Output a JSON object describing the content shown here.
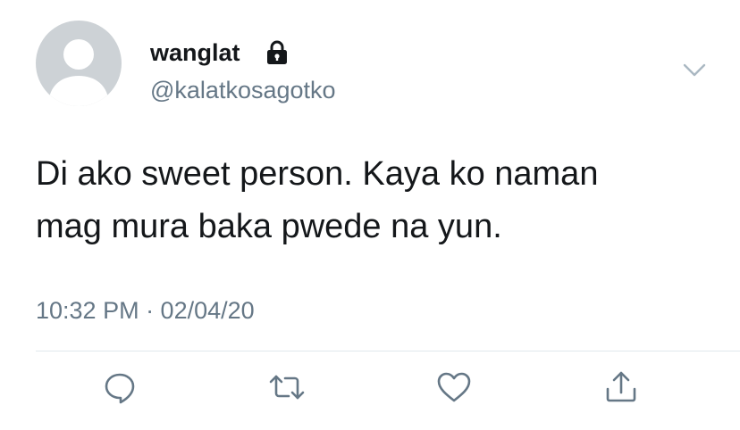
{
  "tweet": {
    "display_name": "wanglat",
    "handle": "@kalatkosagotko",
    "protected_icon": "lock-icon",
    "text_lines": [
      "Di ako sweet person. Kaya ko naman",
      "mag mura baka pwede na yun."
    ],
    "timestamp": "10:32 PM · 02/04/20"
  },
  "actions": [
    {
      "name": "reply",
      "icon": "speech-bubble-icon"
    },
    {
      "name": "retweet",
      "icon": "retweet-arrows-icon"
    },
    {
      "name": "like",
      "icon": "heart-icon"
    },
    {
      "name": "share",
      "icon": "share-upload-icon"
    }
  ],
  "colors": {
    "text_primary": "#14171a",
    "text_secondary": "#657786",
    "icon_gray": "#657786",
    "avatar_bg": "#cdd2d6",
    "divider": "#e1e8ed",
    "chevron": "#aab8c2"
  }
}
